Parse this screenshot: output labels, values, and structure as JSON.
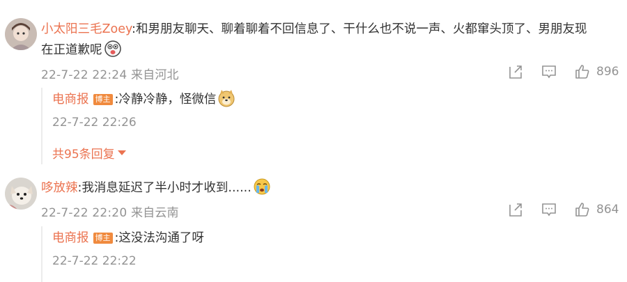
{
  "comments": [
    {
      "username": "小太阳三毛Zoey",
      "text_line1": ":和男朋友聊天、聊着聊着不回信息了、干什么也不说一声、火都窜头顶了、男朋友现",
      "text_line2": "在正道歉呢",
      "text_emoji": "surprised-face-emoji",
      "time_location": "22-7-22 22:24 来自河北",
      "likes": "896",
      "reply": {
        "author": "电商报",
        "badge": "博主",
        "text": ":冷静冷静，怪微信",
        "emoji": "doge-emoji",
        "time": "22-7-22 22:26",
        "more_label": "共95条回复"
      }
    },
    {
      "username": "哆放辣",
      "text_line1": ":我消息延迟了半小时才收到......",
      "text_emoji": "crying-face-emoji",
      "time_location": "22-7-22 22:20 来自云南",
      "likes": "864",
      "reply": {
        "author": "电商报",
        "badge": "博主",
        "text": ":这没法沟通了呀",
        "time": "22-7-22 22:22"
      }
    }
  ],
  "colors": {
    "username": "#eb7350",
    "meta": "#939393",
    "badge": "#f08a3e",
    "text": "#333333"
  },
  "icons": [
    "share-icon",
    "comment-icon",
    "like-icon"
  ]
}
